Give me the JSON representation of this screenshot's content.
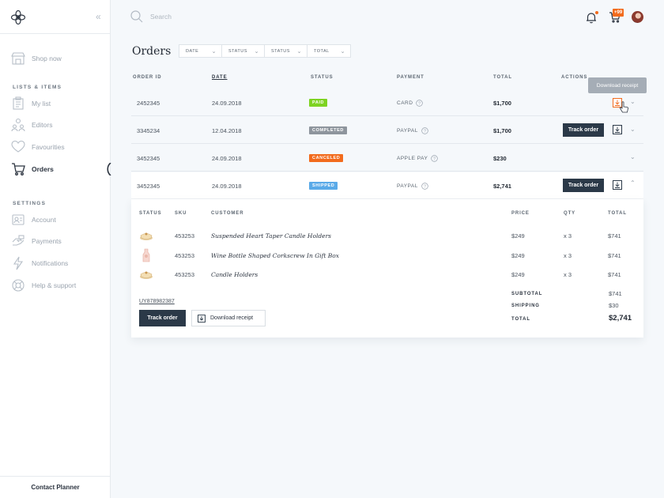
{
  "search": {
    "placeholder": "Search"
  },
  "header": {
    "cart_badge": "+99",
    "title": "Orders"
  },
  "sidebar": {
    "shop_now": "Shop now",
    "section_lists": "LISTS & ITEMS",
    "section_settings": "SETTINGS",
    "items": [
      {
        "label": "My list"
      },
      {
        "label": "Editors"
      },
      {
        "label": "Favourities"
      },
      {
        "label": "Orders"
      }
    ],
    "settings": [
      {
        "label": "Account"
      },
      {
        "label": "Payments"
      },
      {
        "label": "Notifications"
      },
      {
        "label": "Help & support"
      }
    ],
    "contact": "Contact Planner"
  },
  "filters": [
    "DATE",
    "STATUS",
    "STATUS",
    "TOTAL"
  ],
  "table": {
    "headers": {
      "order_id": "ORDER ID",
      "date": "DATE",
      "status": "STATUS",
      "payment": "PAYMENT",
      "total": "TOTAL",
      "actions": "ACTIONS"
    },
    "rows": [
      {
        "order_id": "2452345",
        "date": "24.09.2018",
        "status": "PAID",
        "status_color": "#7ed321",
        "payment": "CARD",
        "total": "$1,700"
      },
      {
        "order_id": "3345234",
        "date": "12.04.2018",
        "status": "COMPLETED",
        "status_color": "#8e959d",
        "payment": "PAYPAL",
        "total": "$1,700"
      },
      {
        "order_id": "3452345",
        "date": "24.09.2018",
        "status": "CANCELED",
        "status_color": "#f26b1d",
        "payment": "APPLE PAY",
        "total": "$230"
      },
      {
        "order_id": "3452345",
        "date": "24.09.2018",
        "status": "SHIPPED",
        "status_color": "#5aaae8",
        "payment": "PAYPAL",
        "total": "$2,741"
      }
    ],
    "track_label": "Track order",
    "tooltip": "Download receipt"
  },
  "details": {
    "headers": {
      "status": "STATUS",
      "sku": "SKU",
      "customer": "CUSTOMER",
      "price": "PRICE",
      "qty": "QTY",
      "total": "TOTAL"
    },
    "items": [
      {
        "sku": "453253",
        "product": "Suspended Heart Taper Candle Holders",
        "price": "$249",
        "qty": "x 3",
        "total": "$741"
      },
      {
        "sku": "453253",
        "product": "Wine Bottle Shaped Corkscrew In Gift Box",
        "price": "$249",
        "qty": "x 3",
        "total": "$741"
      },
      {
        "sku": "453253",
        "product": "Candle Holders",
        "price": "$249",
        "qty": "x 3",
        "total": "$741"
      }
    ],
    "tracking_number": "UY878982387",
    "track_label": "Track order",
    "download_label": "Download receipt",
    "subtotal_label": "SUBTOTAL",
    "subtotal": "$741",
    "shipping_label": "SHIPPING",
    "shipping": "$30",
    "total_label": "TOTAL",
    "total": "$2,741"
  },
  "colors": {
    "accent": "#f26b1d",
    "dark_button": "#2b3948"
  }
}
